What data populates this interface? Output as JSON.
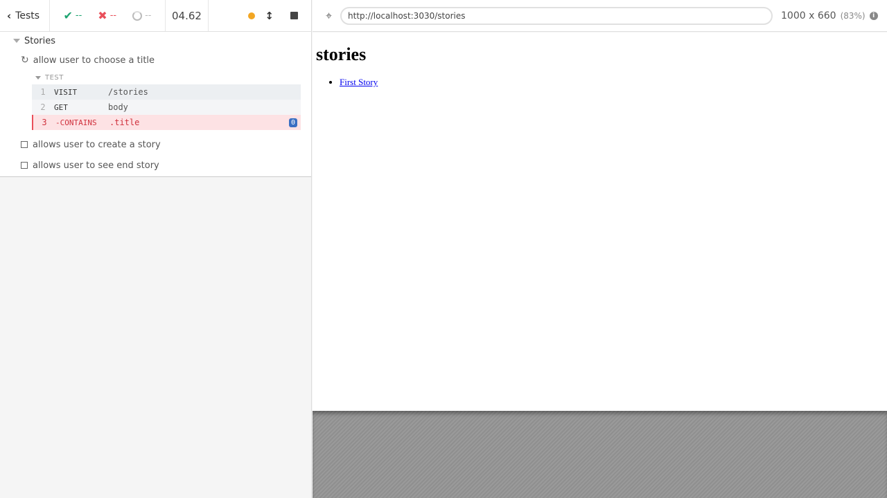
{
  "reporter": {
    "back_label": "Tests",
    "stats": {
      "passed": "--",
      "failed": "--",
      "pending": "--"
    },
    "duration": "04.62",
    "status_dot_color": "#f2a623",
    "suite_title": "Stories",
    "tests": [
      {
        "title": "allow user to choose a title",
        "state": "running",
        "hooks_label": "TEST",
        "commands": [
          {
            "num": "1",
            "name": "VISIT",
            "message": "/stories"
          },
          {
            "num": "2",
            "name": "GET",
            "message": "body"
          },
          {
            "num": "3",
            "name": "-CONTAINS",
            "message": ".title",
            "badge": "0",
            "state": "failed"
          }
        ]
      },
      {
        "title": "allows user to create a story",
        "state": "pending"
      },
      {
        "title": "allows user to see end story",
        "state": "pending"
      }
    ]
  },
  "aut": {
    "url": "http://localhost:3030/stories",
    "viewport": "1000 x 660",
    "scale": "(83%)",
    "page": {
      "heading": "stories",
      "links": [
        "First Story"
      ]
    }
  }
}
